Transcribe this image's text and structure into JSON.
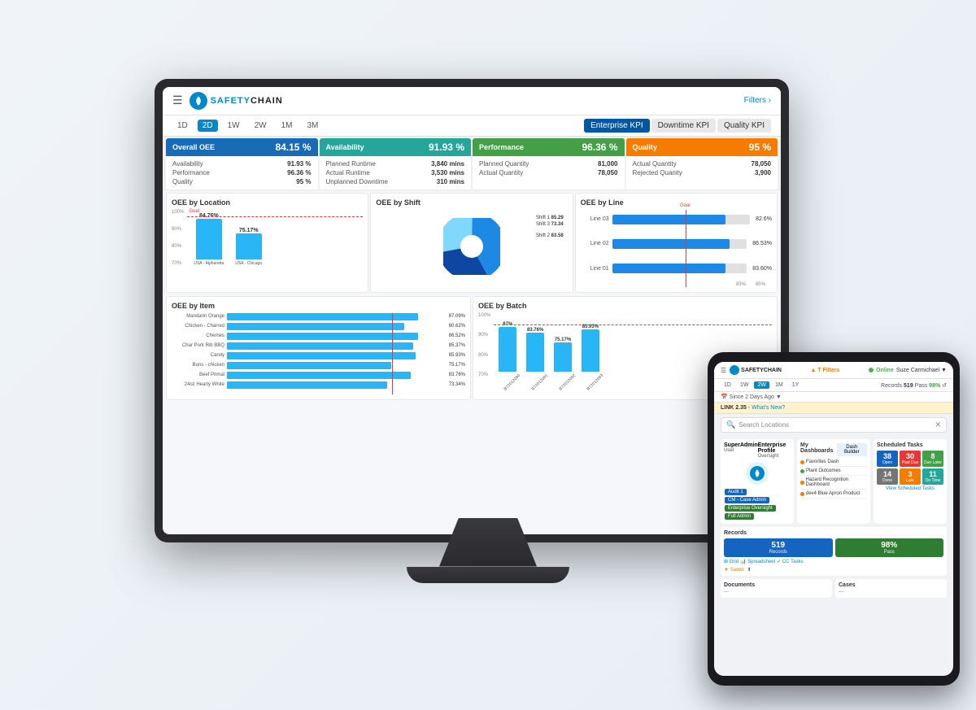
{
  "app": {
    "title": "SafetyChain",
    "logo_text": "SAFETYCHAIN",
    "filters_label": "Filters ›",
    "hamburger": "☰"
  },
  "time_filters": {
    "buttons": [
      "1D",
      "2D",
      "1W",
      "2W",
      "1M",
      "3M"
    ],
    "active": "2D"
  },
  "kpi_tabs": [
    {
      "label": "Enterprise KPI",
      "active": true
    },
    {
      "label": "Downtime KPI",
      "active": false
    },
    {
      "label": "Quality KPI",
      "active": false
    }
  ],
  "kpi_cards": [
    {
      "id": "oee",
      "title": "Overall OEE",
      "value": "84.15 %",
      "details": [
        {
          "label": "Availability",
          "value": "91.93 %"
        },
        {
          "label": "Performance",
          "value": "96.36 %"
        },
        {
          "label": "Quality",
          "value": "95 %"
        }
      ]
    },
    {
      "id": "availability",
      "title": "Availability",
      "value": "91.93 %",
      "details": [
        {
          "label": "Planned Runtime",
          "value": "3,840 mins"
        },
        {
          "label": "Actual Runtime",
          "value": "3,530 mins"
        },
        {
          "label": "Unplanned Downtime",
          "value": "310 mins"
        }
      ]
    },
    {
      "id": "performance",
      "title": "Performance",
      "value": "96.36 %",
      "details": [
        {
          "label": "Planned Quantity",
          "value": "81,000"
        },
        {
          "label": "Actual Quantity",
          "value": "78,050"
        }
      ]
    },
    {
      "id": "quality",
      "title": "Quality",
      "value": "95 %",
      "details": [
        {
          "label": "Actual Quantity",
          "value": "78,050"
        },
        {
          "label": "Rejected Quanity",
          "value": "3,900"
        }
      ]
    }
  ],
  "charts": {
    "oee_by_location": {
      "title": "OEE by Location",
      "bars": [
        {
          "label": "USA - Alpharetta",
          "value": 84.76,
          "display": "84.76%"
        },
        {
          "label": "USA - Chicago",
          "value": 75.17,
          "display": "75.17%"
        }
      ],
      "goal": 80,
      "goal_label": "Goal",
      "y_labels": [
        "100%",
        "90%",
        "80%",
        "70%"
      ]
    },
    "oee_by_shift": {
      "title": "OEE by Shift",
      "slices": [
        {
          "label": "Shift 1",
          "value": "85.29",
          "color": "#1e88e5"
        },
        {
          "label": "Shift 2",
          "value": "83.58",
          "color": "#0d47a1"
        },
        {
          "label": "Shift 3",
          "value": "73.34",
          "color": "#80d8ff"
        }
      ]
    },
    "oee_by_line": {
      "title": "OEE by Line",
      "bars": [
        {
          "label": "Line 03",
          "value": 82.6,
          "display": "82.6%"
        },
        {
          "label": "Line 02",
          "value": 86.53,
          "display": "86.53%"
        },
        {
          "label": "Line 01",
          "value": 83.6,
          "display": "83.60%"
        }
      ],
      "goal": 83,
      "x_labels": [
        "83%",
        "85%"
      ]
    },
    "oee_by_item": {
      "title": "OEE by Item",
      "bars": [
        {
          "label": "Mandarin Orange",
          "value": 87.09,
          "display": "87.09%"
        },
        {
          "label": "Chicken - Charred",
          "value": 80.62,
          "display": "80.62%"
        },
        {
          "label": "Cherries",
          "value": 86.52,
          "display": "86.52%"
        },
        {
          "label": "Char Pork Rib BBQ",
          "value": 85.37,
          "display": "85.37%"
        },
        {
          "label": "Candy",
          "value": 85.93,
          "display": "85.93%"
        },
        {
          "label": "Buns - chicken",
          "value": 75.17,
          "display": "75.17%"
        },
        {
          "label": "Beef Primal",
          "value": 83.76,
          "display": "83.76%"
        },
        {
          "label": "24oz Hearty White",
          "value": 73.34,
          "display": "73.34%"
        }
      ]
    },
    "oee_by_batch": {
      "title": "OEE by Batch",
      "bars": [
        {
          "label": "BT2012090",
          "value": 87,
          "display": "87%"
        },
        {
          "label": "BT2012091",
          "value": 83.76,
          "display": "83.76%"
        },
        {
          "label": "BT2012092",
          "value": 75.17,
          "display": "75.17%"
        },
        {
          "label": "BT2012093",
          "value": 85.93,
          "display": "85.93%"
        }
      ],
      "y_labels": [
        "100%",
        "90%",
        "80%",
        "70%"
      ]
    }
  },
  "tablet": {
    "online_text": "Online",
    "user": "Suze Carmichael",
    "logo_text": "SAFETYCHAIN",
    "alert_text": "▲ T Filters",
    "link_version": "LINK 2.35",
    "whats_new": "What's New?",
    "time_filters": [
      "1D",
      "1W",
      "2W",
      "1M",
      "1Y"
    ],
    "active_filter": "1W",
    "records_count": "519",
    "pass_pct": "98%",
    "search_placeholder": "Search Locations",
    "since_text": "Since 2 Days Ago ▼",
    "sections": {
      "profile": {
        "title1": "SuperAdmin",
        "title2": "User",
        "title3": "Enterprise Profile",
        "title4": "Oversight",
        "badges": [
          "Audit 1",
          "CM - Case Admin",
          "Enterprise Oversight",
          "Full Admin"
        ]
      },
      "dashboards": {
        "title": "My Dashboards",
        "dash_builder": "Dash Builder",
        "items": [
          "Favorites Dash",
          "Plant Outcomes",
          "Hazard Recognition Dashboard",
          "dev4  Blue Apron Product"
        ]
      },
      "records": {
        "title": "Records",
        "count": "519",
        "pass_count": "98%",
        "label_records": "Records",
        "label_pass": "Pass",
        "actions": [
          "Grid",
          "Spreadsheet",
          "CC Tasks"
        ]
      },
      "scheduled_tasks": {
        "title": "Scheduled Tasks",
        "cells": [
          {
            "label": "Open",
            "value": "38",
            "type": "open"
          },
          {
            "label": "Past Due",
            "value": "30",
            "type": "past-due"
          },
          {
            "label": "Due Later",
            "value": "8",
            "type": "due-later"
          },
          {
            "label": "Done",
            "value": "14",
            "type": "done"
          },
          {
            "label": "Late",
            "value": "3",
            "type": "late"
          },
          {
            "label": "On Time",
            "value": "11",
            "type": "on-time"
          }
        ],
        "view_link": "View Scheduled Tasks"
      },
      "documents": {
        "title": "Documents"
      },
      "cases": {
        "title": "Cases"
      }
    }
  }
}
